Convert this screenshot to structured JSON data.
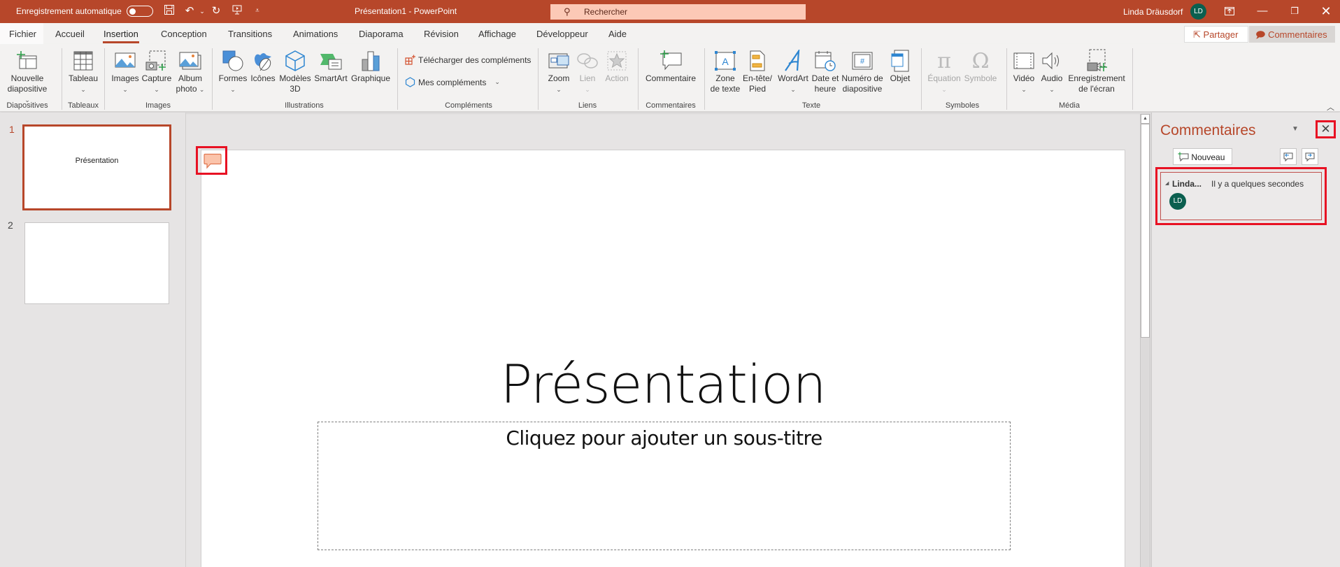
{
  "titlebar": {
    "autosave_label": "Enregistrement automatique",
    "autosave_state": "off",
    "title": "Présentation1  -  PowerPoint",
    "search_placeholder": "Rechercher",
    "user_name": "Linda Dräusdorf",
    "user_initials": "LD",
    "quick_access": [
      "save-icon",
      "undo-icon",
      "redo-icon",
      "present-icon",
      "customize-icon"
    ]
  },
  "tabs": [
    "Fichier",
    "Accueil",
    "Insertion",
    "Conception",
    "Transitions",
    "Animations",
    "Diaporama",
    "Révision",
    "Affichage",
    "Développeur",
    "Aide"
  ],
  "active_tab": "Insertion",
  "header_buttons": {
    "share": "Partager",
    "comments": "Commentaires"
  },
  "ribbon": {
    "groups": {
      "diapositives": "Diapositives",
      "tableaux": "Tableaux",
      "images": "Images",
      "illustrations": "Illustrations",
      "complements": "Compléments",
      "liens": "Liens",
      "commentaires": "Commentaires",
      "texte": "Texte",
      "symboles": "Symboles",
      "media": "Média"
    },
    "buttons": {
      "nouvelle_l1": "Nouvelle",
      "nouvelle_l2": "diapositive",
      "tableau": "Tableau",
      "images": "Images",
      "capture": "Capture",
      "album_l1": "Album",
      "album_l2": "photo",
      "formes": "Formes",
      "icones": "Icônes",
      "modeles_l1": "Modèles",
      "modeles_l2": "3D",
      "smartart": "SmartArt",
      "graphique": "Graphique",
      "telecharger": "Télécharger des compléments",
      "mes_complements": "Mes compléments",
      "zoom": "Zoom",
      "lien": "Lien",
      "action": "Action",
      "commentaire": "Commentaire",
      "zone_l1": "Zone",
      "zone_l2": "de texte",
      "entete_l1": "En-tête/",
      "entete_l2": "Pied",
      "wordart": "WordArt",
      "date_l1": "Date et",
      "date_l2": "heure",
      "numero_l1": "Numéro de",
      "numero_l2": "diapositive",
      "objet": "Objet",
      "equation": "Équation",
      "symbole": "Symbole",
      "video": "Vidéo",
      "audio": "Audio",
      "enreg_l1": "Enregistrement",
      "enreg_l2": "de l'écran"
    }
  },
  "slides": [
    {
      "number": "1",
      "thumb_text": "Présentation",
      "selected": true
    },
    {
      "number": "2",
      "thumb_text": "",
      "selected": false
    }
  ],
  "slide": {
    "title": "Présentation",
    "subtitle_placeholder": "Cliquez pour ajouter un sous-titre"
  },
  "comments_pane": {
    "title": "Commentaires",
    "new_button": "Nouveau",
    "comments": [
      {
        "author": "Linda...",
        "time": "Il y a quelques secondes",
        "initials": "LD"
      }
    ]
  },
  "colors": {
    "brand": "#b7472a",
    "highlight": "#e81123",
    "avatar": "#0b5f4f"
  }
}
